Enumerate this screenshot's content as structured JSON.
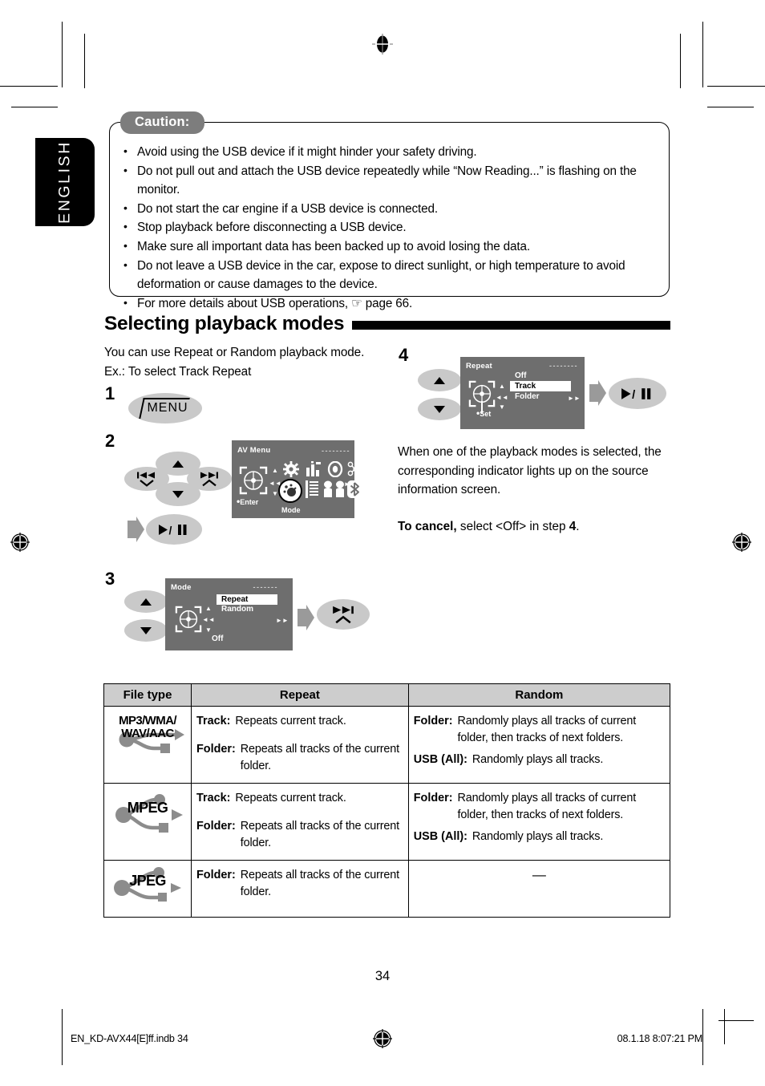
{
  "language_tab": "ENGLISH",
  "caution": {
    "tag": "Caution:",
    "items": [
      "Avoid using the USB device if it might hinder your safety driving.",
      "Do not pull out and attach the USB device repeatedly while “Now Reading...” is flashing on the monitor.",
      "Do not start the car engine if a USB device is connected.",
      "Stop playback before disconnecting a USB device.",
      "Make sure all important data has been backed up to avoid losing the data.",
      "Do not leave a USB device in the car, expose to direct sunlight, or high temperature to avoid deformation or cause damages to the device.",
      "For more details about USB operations, ☞ page 66."
    ]
  },
  "section": {
    "title": "Selecting playback modes",
    "intro_line1": "You can use Repeat or Random playback mode.",
    "intro_line2": "Ex.:  To select Track Repeat"
  },
  "steps": {
    "one": {
      "number": "1",
      "button_label": "MENU"
    },
    "two": {
      "number": "2",
      "buttons": {
        "prev": "◄◄",
        "next": "►►",
        "up": "▲",
        "down": "▼",
        "play_pause": "►/❚❚"
      },
      "screen": {
        "title": "AV Menu",
        "dashes": "- - - - - - - -",
        "enter_label": "Enter",
        "mode_label": "Mode",
        "icons_row1": [
          "gear-icon",
          "equalizer-icon",
          "disc-icon",
          "network-icon"
        ],
        "icons_row2": [
          "mode-icon",
          "list-icon",
          "speakers-icon",
          "bluetooth-icon"
        ]
      }
    },
    "three": {
      "number": "3",
      "screen": {
        "title": "Mode",
        "dashes": "- - - - - - -",
        "options": [
          "Repeat",
          "Random"
        ],
        "selected": "Repeat",
        "bottom_label": "Off"
      },
      "confirm_button": "►►|"
    },
    "four": {
      "number": "4",
      "screen": {
        "title": "Repeat",
        "dashes": "- - - - - - - -",
        "options": [
          "Off",
          "Track",
          "Folder"
        ],
        "selected": "Track",
        "set_label": "Set"
      },
      "confirm_button": "►/❚❚"
    }
  },
  "note": {
    "paragraph": "When one of the playback modes is selected, the corresponding indicator lights up on the source information screen.",
    "cancel_bold": "To cancel,",
    "cancel_rest": " select <Off> in step ",
    "cancel_step": "4",
    "cancel_end": "."
  },
  "table": {
    "headers": [
      "File type",
      "Repeat",
      "Random"
    ],
    "rows": [
      {
        "file_type": "MP3/WMA/\nWAV/AAC",
        "file_type_icon": "usb-icon",
        "repeat": [
          {
            "key": "Track:",
            "value": "Repeats current track."
          },
          {
            "key": "Folder:",
            "value": "Repeats all tracks of the current folder."
          }
        ],
        "random": [
          {
            "key": "Folder:",
            "value": "Randomly plays all tracks of current folder, then tracks of next folders."
          },
          {
            "key": "USB (All):",
            "value": "Randomly plays all tracks."
          }
        ]
      },
      {
        "file_type": "MPEG",
        "file_type_icon": "usb-icon",
        "repeat": [
          {
            "key": "Track:",
            "value": "Repeats current track."
          },
          {
            "key": "Folder:",
            "value": "Repeats all tracks of the current folder."
          }
        ],
        "random": [
          {
            "key": "Folder:",
            "value": "Randomly plays all tracks of current folder, then tracks of next folders."
          },
          {
            "key": "USB (All):",
            "value": "Randomly plays all tracks."
          }
        ]
      },
      {
        "file_type": "JPEG",
        "file_type_icon": "usb-icon",
        "repeat": [
          {
            "key": "Folder:",
            "value": "Repeats all tracks of the current folder."
          }
        ],
        "random_dash": "—"
      }
    ]
  },
  "page_number": "34",
  "footer": {
    "left": "EN_KD-AVX44[E]ff.indb   34",
    "right": "08.1.18   8:07:21 PM"
  },
  "colors": {
    "screen_bg": "#6e6e6e",
    "button_grey": "#c9c9c9",
    "header_grey": "#cdcdcd",
    "caution_tag_grey": "#7d7d7d"
  }
}
